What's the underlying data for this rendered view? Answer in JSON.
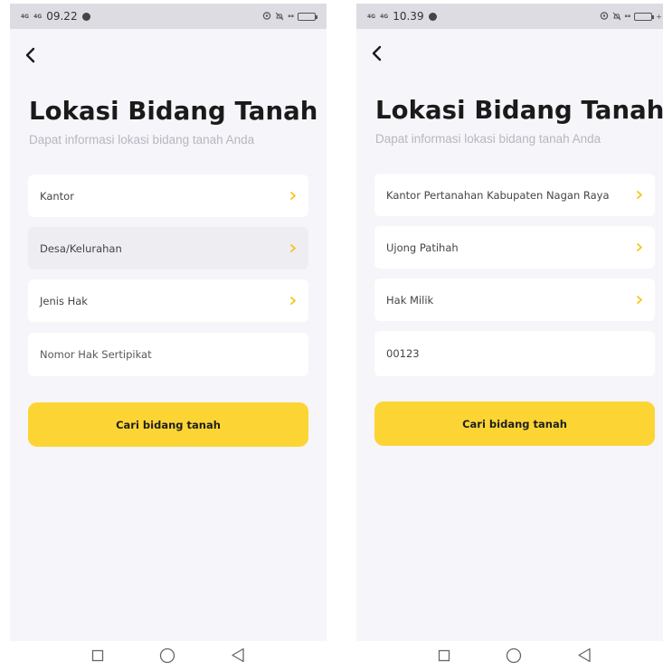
{
  "left_screen": {
    "status_bar": {
      "signal_1": "4G",
      "signal_2": "4G",
      "time": "09.22"
    },
    "title": "Lokasi Bidang Tanah",
    "subtitle": "Dapat informasi lokasi bidang tanah Anda",
    "fields": {
      "kantor": "Kantor",
      "desa": "Desa/Kelurahan",
      "jenis_hak": "Jenis Hak"
    },
    "nomor_input": {
      "value": "",
      "placeholder": "Nomor Hak Sertipikat"
    },
    "search_button": "Cari bidang tanah"
  },
  "right_screen": {
    "status_bar": {
      "signal_1": "4G",
      "signal_2": "4G",
      "time": "10.39"
    },
    "title": "Lokasi Bidang Tanah",
    "subtitle": "Dapat informasi lokasi bidang tanah Anda",
    "fields": {
      "kantor": "Kantor Pertanahan Kabupaten Nagan Raya",
      "desa": "Ujong Patihah",
      "jenis_hak": "Hak Milik"
    },
    "nomor_input": {
      "value": "00123",
      "placeholder": "Nomor Hak Sertipikat"
    },
    "search_button": "Cari bidang tanah"
  },
  "icons": {
    "back": "chevron-left-icon",
    "field_arrow": "chevron-right-icon",
    "nav_recents": "square-icon",
    "nav_home": "circle-icon",
    "nav_back": "triangle-back-icon",
    "status_location": "location-icon",
    "status_mute": "mute-icon",
    "status_battery": "battery-icon"
  },
  "colors": {
    "screen_bg": "#f5f5fa",
    "card_bg": "#ffffff",
    "card_muted_bg": "#eeeef2",
    "accent": "#fcd534",
    "chevron": "#f5c518",
    "title": "#1a1a1a",
    "subtitle": "#b7b7c0",
    "status_bar": "#dcdce2"
  }
}
